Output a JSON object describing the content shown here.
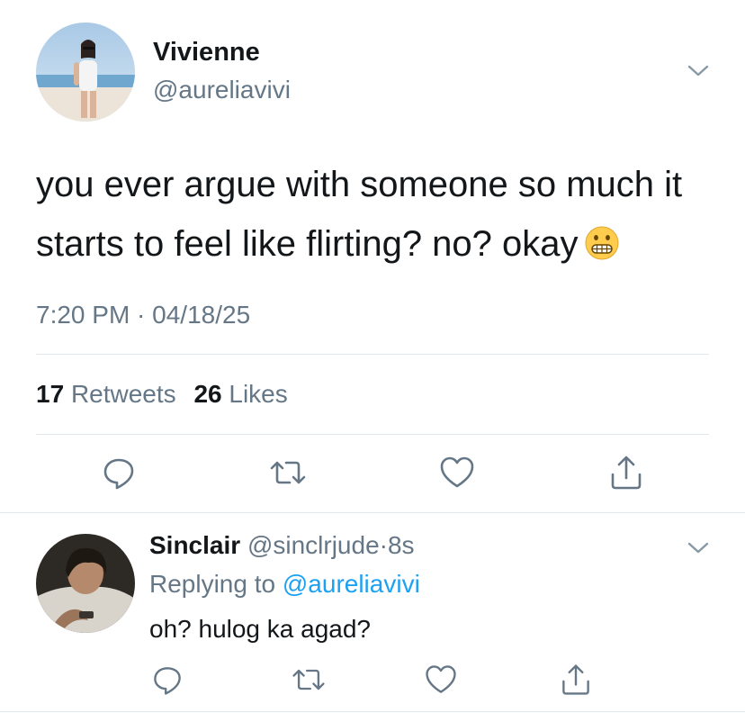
{
  "tweet": {
    "author_name": "Vivienne",
    "author_handle": "@aureliavivi",
    "text": "you ever argue with someone so much it starts to feel like flirting? no? okay",
    "emoji": "grimacing-face",
    "timestamp": "7:20 PM · 04/18/25",
    "retweets_count": "17",
    "retweets_label": "Retweets",
    "likes_count": "26",
    "likes_label": "Likes"
  },
  "reply": {
    "author_name": "Sinclair",
    "author_handle": "@sinclrjude",
    "separator": "·",
    "time": "8s",
    "replying_prefix": "Replying to",
    "replying_to": "@aureliavivi",
    "text": "oh? hulog ka agad?"
  },
  "icons": {
    "reply": "speech-bubble-icon",
    "retweet": "retweet-icon",
    "like": "heart-icon",
    "share": "share-icon",
    "more": "chevron-down-icon"
  },
  "colors": {
    "text": "#14171a",
    "secondary": "#657786",
    "link": "#1da1f2",
    "divider": "#e1e8ed"
  }
}
